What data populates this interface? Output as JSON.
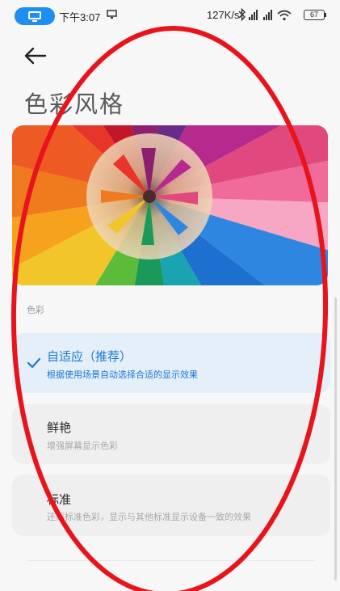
{
  "status_bar": {
    "time": "下午3:07",
    "net_speed": "127K/s",
    "battery": "67"
  },
  "header": {
    "title": "色彩风格"
  },
  "section": {
    "label": "色彩"
  },
  "options": [
    {
      "title": "自适应（推荐）",
      "subtitle": "根据使用场景自动选择合适的显示效果",
      "selected": true
    },
    {
      "title": "鲜艳",
      "subtitle": "增强屏幕显示色彩",
      "selected": false
    },
    {
      "title": "标准",
      "subtitle": "还原标准色彩，显示与其他标准显示设备一致的效果",
      "selected": false
    }
  ],
  "colors": {
    "accent": "#1976d2",
    "selected_background": "#e4effa",
    "annotation": "#e8141b"
  },
  "icons": {
    "status_pill": "screen-cast-pill-icon",
    "cast": "cast-icon",
    "bluetooth": "bluetooth-icon",
    "signal": "cellular-signal-icon",
    "wifi": "wifi-icon",
    "back": "back-arrow-icon",
    "check": "check-icon"
  }
}
